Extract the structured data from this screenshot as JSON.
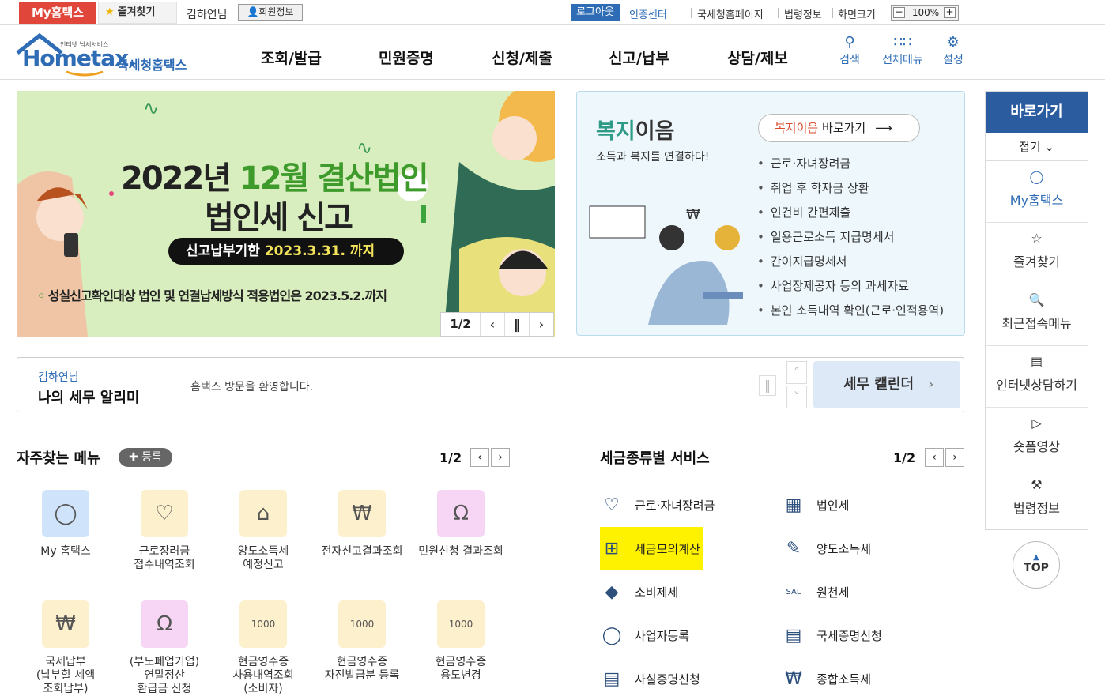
{
  "topbar": {
    "my_hometax": "My홈택스",
    "favorites": "즐겨찾기",
    "user_name": "김하연님",
    "member_info": "회원정보",
    "logout": "로그아웃",
    "cert_center": "인증센터",
    "links": [
      "국세청홈페이지",
      "법령정보",
      "화면크기"
    ],
    "zoom": "100%"
  },
  "header": {
    "logo_small": "인터넷 납세서비스",
    "logo_main": "Hometax.",
    "logo_kr": "국세청홈택스",
    "nav": [
      "조회/발급",
      "민원증명",
      "신청/제출",
      "신고/납부",
      "상담/제보"
    ],
    "tools": [
      "검색",
      "전체메뉴",
      "설정"
    ]
  },
  "banner": {
    "title1": "2022년 ",
    "title1_accent": "12월 결산법인",
    "title2": "법인세 신고",
    "deadline_label": "신고납부기한",
    "deadline_date": "2023.3.31. 까지",
    "note": "성실신고확인대상 법인 및 연결납세방식 적용법인은 2023.5.2.까지",
    "page": "1/2"
  },
  "bokji": {
    "title_a": "복지",
    "title_b": "이음",
    "subtitle": "소득과 복지를 연결하다!",
    "link_accent": "복지이음",
    "link_rest": " 바로가기",
    "items": [
      "근로·자녀장려금",
      "취업 후 학자금 상환",
      "인건비 간편제출",
      "일용근로소득 지급명세서",
      "간이지급명세서",
      "사업장제공자 등의 과세자료",
      "본인 소득내역 확인(근로·인적용역)"
    ]
  },
  "quick": {
    "title": "바로가기",
    "fold": "접기",
    "items": [
      "My홈택스",
      "즐겨찾기",
      "최근접속메뉴",
      "인터넷상담하기",
      "숏폼영상",
      "법령정보"
    ],
    "top": "TOP"
  },
  "alarm": {
    "user": "김하연님",
    "title": "나의 세무 알리미",
    "message": "홈택스 방문을 환영합니다.",
    "calendar": "세무 캘린더"
  },
  "frequent": {
    "title": "자주찾는 메뉴",
    "add": "등록",
    "page": "1/2",
    "items": [
      {
        "label": "My 홈택스",
        "icon": "person-icon",
        "color": "#cfe3fb"
      },
      {
        "label": "근로장려금\n접수내역조회",
        "icon": "heart-hand-icon",
        "color": "#fdf0cc"
      },
      {
        "label": "양도소득세\n예정신고",
        "icon": "house-icon",
        "color": "#fdf0cc"
      },
      {
        "label": "전자신고결과조회",
        "icon": "monitor-search-icon",
        "color": "#fdf0cc"
      },
      {
        "label": "민원신청 결과조회",
        "icon": "headset-icon",
        "color": "#f6d6f4"
      },
      {
        "label": "국세납부\n(납부할 세액\n조회납부)",
        "icon": "money-bag-icon",
        "color": "#fdf0cc"
      },
      {
        "label": "(부도폐업기업)\n연말정산\n환급금 신청",
        "icon": "headset-icon",
        "color": "#f6d6f4"
      },
      {
        "label": "현금영수증\n사용내역조회\n(소비자)",
        "icon": "receipt-search-icon",
        "color": "#fdf0cc"
      },
      {
        "label": "현금영수증\n자진발급분 등록",
        "icon": "receipt-search-icon",
        "color": "#fdf0cc"
      },
      {
        "label": "현금영수증\n용도변경",
        "icon": "receipt-search-icon",
        "color": "#fdf0cc"
      }
    ]
  },
  "taxservice": {
    "title": "세금종류별 서비스",
    "page": "1/2",
    "items": [
      {
        "label": "근로·자녀장려금",
        "icon": "heart-hand-icon"
      },
      {
        "label": "법인세",
        "icon": "building-icon"
      },
      {
        "label": "세금모의계산",
        "icon": "calculator-icon",
        "highlight": true
      },
      {
        "label": "양도소득세",
        "icon": "document-pen-icon"
      },
      {
        "label": "소비제세",
        "icon": "diamond-icon"
      },
      {
        "label": "원천세",
        "icon": "salary-doc-icon"
      },
      {
        "label": "사업자등록",
        "icon": "person-icon"
      },
      {
        "label": "국세증명신청",
        "icon": "document-icon"
      },
      {
        "label": "사실증명신청",
        "icon": "document-icon"
      },
      {
        "label": "종합소득세",
        "icon": "money-bag-icon"
      }
    ]
  }
}
